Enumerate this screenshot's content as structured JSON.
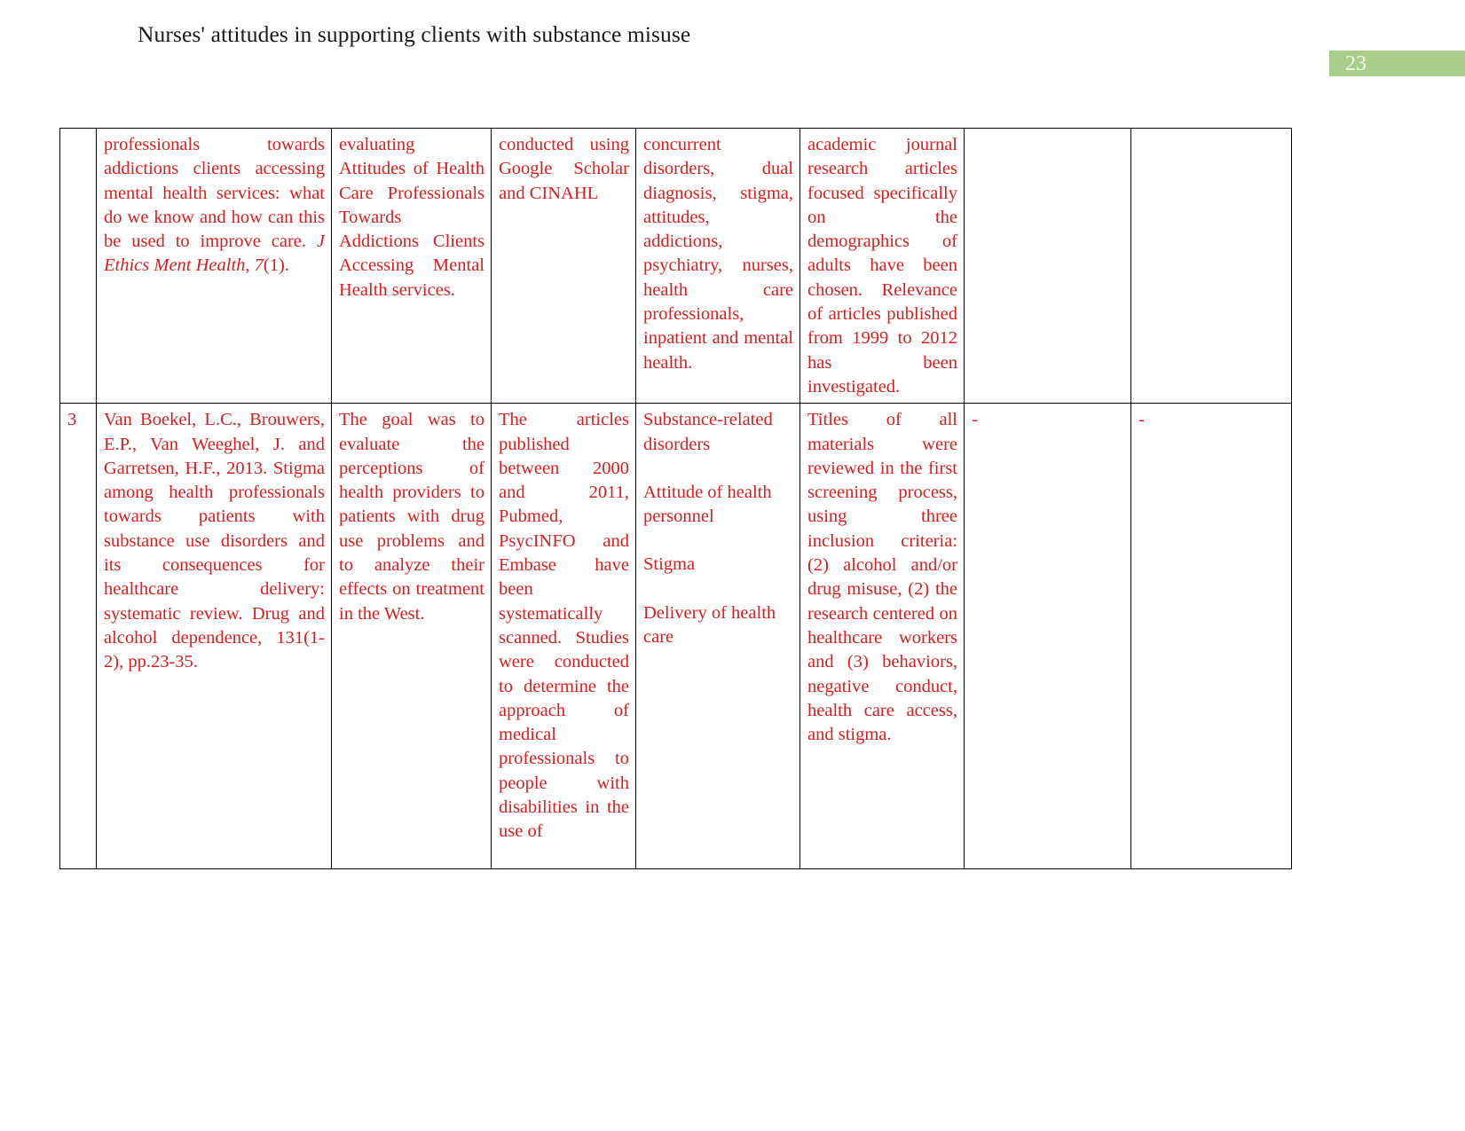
{
  "header": {
    "title": "Nurses' attitudes in supporting clients with substance misuse",
    "page_number": "23",
    "band_color": "#a9cd8b"
  },
  "theme": {
    "table_text_color": "#e01b1b",
    "header_text_color": "#1a1a1a",
    "border_color": "#000000"
  },
  "table": {
    "rows": [
      {
        "number": "",
        "reference_part1": "professionals towards addictions clients accessing mental health services: what do we know and how can this be used to improve care. ",
        "reference_italic": "J Ethics Ment Health",
        "reference_part2": ", ",
        "reference_italic2": "7",
        "reference_part3": "(1).",
        "aim": "evaluating Attitudes of Health Care Professionals Towards Addictions Clients Accessing Mental Health services.",
        "method": "conducted using Google Scholar and CINAHL",
        "key_concepts": "concurrent disorders, dual diagnosis, stigma, attitudes, addictions, psychiatry, nurses, health care professionals, inpatient and mental health.",
        "inclusion": "academic journal research articles focused specifically on the demographics of adults have been chosen. Relevance of articles published from 1999 to 2012 has been investigated.",
        "exclusion": "",
        "quality": ""
      },
      {
        "number": "3",
        "reference": "Van Boekel, L.C., Brouwers, E.P., Van Weeghel, J. and Garretsen, H.F., 2013. Stigma among health professionals towards patients with substance use disorders and its consequences for healthcare delivery: systematic review. Drug and alcohol dependence, 131(1-2), pp.23-35.",
        "aim": "The goal was to evaluate the perceptions of health providers to patients with drug use problems and to analyze their effects on treatment in the West.",
        "method": "The articles published between 2000 and 2011, Pubmed, PsycINFO and Embase have been systematically scanned. Studies were conducted to determine the approach of medical professionals to people with disabilities in the use of",
        "key_concepts_items": [
          "Substance-related disorders",
          "Attitude of health personnel",
          "Stigma",
          "Delivery of health care"
        ],
        "inclusion": "Titles of all materials were reviewed in the first screening process, using three inclusion criteria: (2) alcohol and/or drug misuse, (2) the research centered on healthcare workers and (3) behaviors, negative conduct, health care access, and stigma.",
        "exclusion": "-",
        "quality": "-"
      }
    ]
  }
}
